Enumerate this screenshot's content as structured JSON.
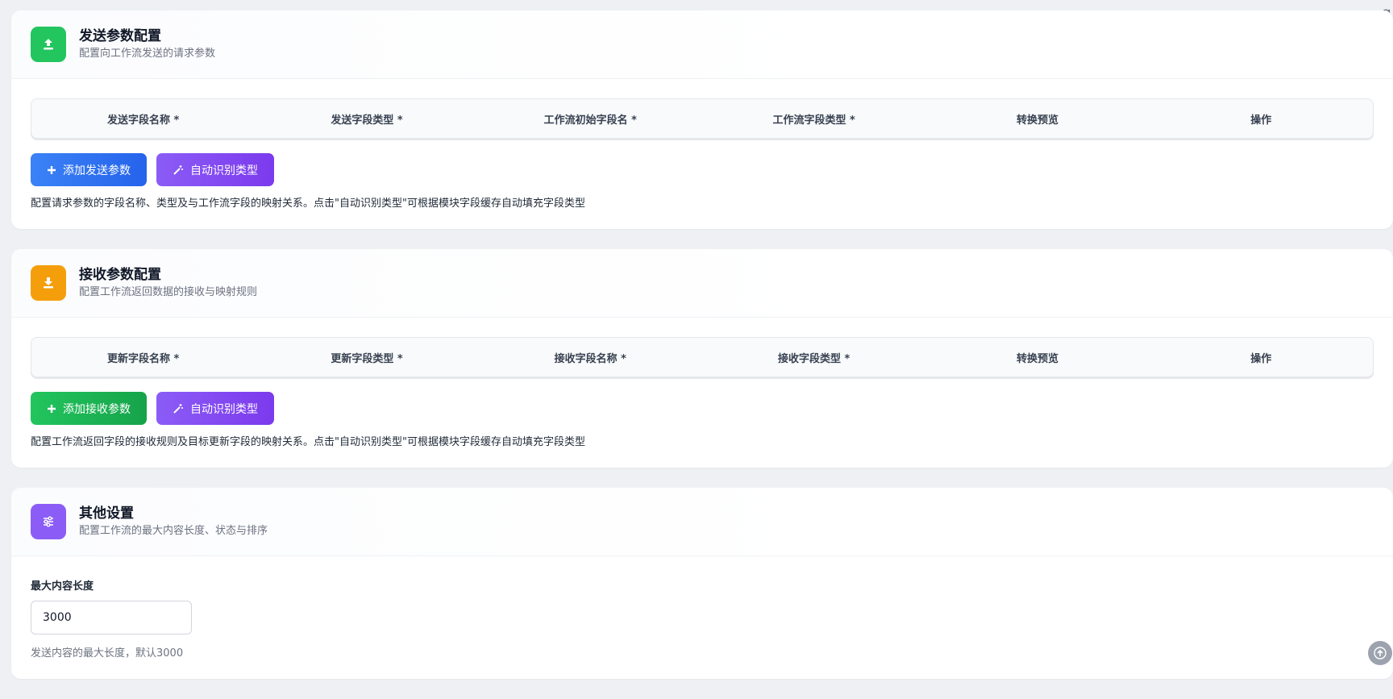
{
  "send": {
    "title": "发送参数配置",
    "subtitle": "配置向工作流发送的请求参数",
    "columns": [
      "发送字段名称 *",
      "发送字段类型 *",
      "工作流初始字段名 *",
      "工作流字段类型 *",
      "转换预览",
      "操作"
    ],
    "add_label": "添加发送参数",
    "auto_label": "自动识别类型",
    "hint": "配置请求参数的字段名称、类型及与工作流字段的映射关系。点击\"自动识别类型\"可根据模块字段缓存自动填充字段类型",
    "icon_color": "#22c55e"
  },
  "receive": {
    "title": "接收参数配置",
    "subtitle": "配置工作流返回数据的接收与映射规则",
    "columns": [
      "更新字段名称 *",
      "更新字段类型 *",
      "接收字段名称 *",
      "接收字段类型 *",
      "转换预览",
      "操作"
    ],
    "add_label": "添加接收参数",
    "auto_label": "自动识别类型",
    "hint": "配置工作流返回字段的接收规则及目标更新字段的映射关系。点击\"自动识别类型\"可根据模块字段缓存自动填充字段类型",
    "icon_color": "#f59e0b"
  },
  "other": {
    "title": "其他设置",
    "subtitle": "配置工作流的最大内容长度、状态与排序",
    "max_len_label": "最大内容长度",
    "max_len_value": "3000",
    "max_len_help": "发送内容的最大长度，默认3000",
    "icon_color": "#8b5cf6"
  },
  "icons": {
    "send": "upload-icon",
    "receive": "download-icon",
    "other": "sliders-icon",
    "add": "plus-icon",
    "auto": "magic-wand-icon",
    "refresh": "refresh-icon",
    "top": "arrow-up-icon"
  }
}
